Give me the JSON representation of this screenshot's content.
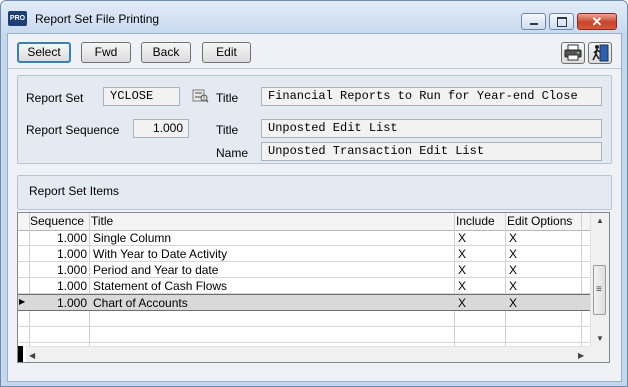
{
  "window": {
    "app_icon_text": "PRO",
    "title": "Report Set File Printing",
    "minimize_glyph": "",
    "maximize_glyph": "",
    "close_glyph": "✕"
  },
  "toolbar": {
    "select_label": "Select",
    "fwd_label": "Fwd",
    "back_label": "Back",
    "edit_label": "Edit",
    "print_icon": "printer-icon",
    "exit_icon": "exit-door-icon"
  },
  "header": {
    "report_set_label": "Report Set",
    "report_set_value": "YCLOSE",
    "title_label_1": "Title",
    "title_value_1": "Financial Reports to Run for Year-end Close",
    "report_sequence_label": "Report Sequence",
    "report_sequence_value": "1.000",
    "title_label_2": "Title",
    "title_value_2": "Unposted Edit List",
    "name_label": "Name",
    "name_value": "Unposted Transaction Edit List"
  },
  "items_panel": {
    "title": "Report Set Items"
  },
  "grid": {
    "columns": [
      "Sequence",
      "Title",
      "Include",
      "Edit Options"
    ],
    "rows": [
      {
        "sequence": "1.000",
        "title": "Single Column",
        "include": "X",
        "edit_options": "X"
      },
      {
        "sequence": "1.000",
        "title": "With Year to Date Activity",
        "include": "X",
        "edit_options": "X"
      },
      {
        "sequence": "1.000",
        "title": "Period and Year to date",
        "include": "X",
        "edit_options": "X"
      },
      {
        "sequence": "1.000",
        "title": "Statement of Cash Flows",
        "include": "X",
        "edit_options": "X"
      },
      {
        "sequence": "1.000",
        "title": "Chart of Accounts",
        "include": "X",
        "edit_options": "X"
      }
    ],
    "selected_row_index": 4,
    "row_pointer_glyph": "▶",
    "scroll_up_glyph": "▲",
    "scroll_down_glyph": "▼",
    "scroll_left_glyph": "◀",
    "scroll_right_glyph": "▶",
    "thumb_grip_glyph": "≡"
  },
  "colors": {
    "accent_border": "#3c7fb1",
    "close_button": "#c8442c",
    "window_frame": "#c5d7ec"
  }
}
